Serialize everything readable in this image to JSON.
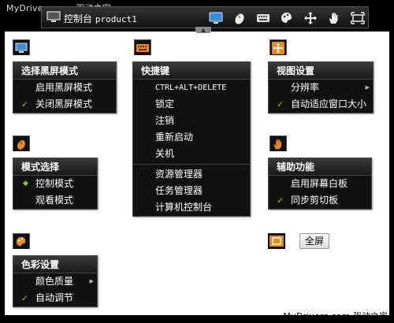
{
  "watermark": {
    "site": "MyDrivers.com",
    "name": "驱动之家"
  },
  "topbar": {
    "title": "控制台",
    "product": "product1",
    "icons": [
      "monitor-icon",
      "mouse-icon",
      "keyboard-icon",
      "palette-icon",
      "move-icon",
      "hand-icon",
      "fullscreen-icon"
    ]
  },
  "screen_menu": {
    "title": "选择黑屏模式",
    "items": [
      {
        "label": "启用黑屏模式",
        "checked": false
      },
      {
        "label": "关闭黑屏模式",
        "checked": true
      }
    ]
  },
  "shortcut_menu": {
    "title": "快捷键",
    "items": [
      {
        "label": "CTRL+ALT+DELETE"
      },
      {
        "label": "锁定"
      },
      {
        "label": "注销"
      },
      {
        "label": "重新启动"
      },
      {
        "label": "关机"
      },
      {
        "label": "资源管理器"
      },
      {
        "label": "任务管理器"
      },
      {
        "label": "计算机控制台"
      }
    ]
  },
  "view_menu": {
    "title": "视图设置",
    "items": [
      {
        "label": "分辨率",
        "submenu": true,
        "checked": false
      },
      {
        "label": "自动适应窗口大小",
        "checked": true
      }
    ]
  },
  "mode_menu": {
    "title": "模式选择",
    "items": [
      {
        "label": "控制模式",
        "selected": true
      },
      {
        "label": "观看模式",
        "selected": false
      }
    ]
  },
  "assist_menu": {
    "title": "辅助功能",
    "items": [
      {
        "label": "启用屏幕白板",
        "checked": false
      },
      {
        "label": "同步剪切板",
        "checked": true
      }
    ]
  },
  "color_menu": {
    "title": "色彩设置",
    "items": [
      {
        "label": "颜色质量",
        "submenu": true,
        "checked": false
      },
      {
        "label": "自动调节",
        "checked": true
      }
    ]
  },
  "fullscreen": {
    "label": "全屏"
  },
  "colors": {
    "check": "#7ec845",
    "icon_orange": "#e8891c",
    "icon_blue": "#3c8fd6"
  }
}
